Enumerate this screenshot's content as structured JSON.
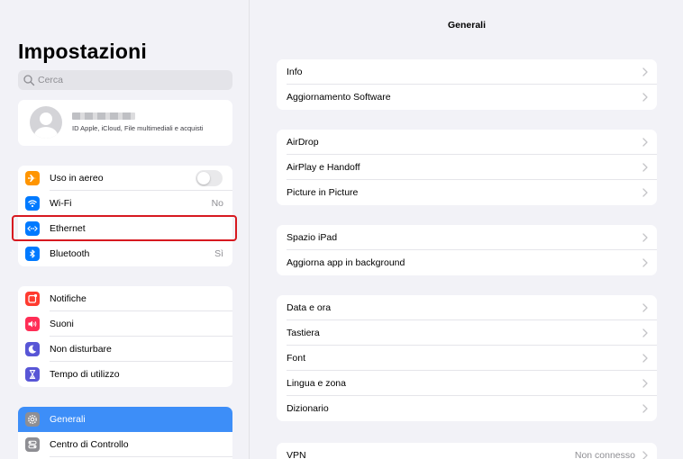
{
  "sidebar": {
    "title": "Impostazioni",
    "search": {
      "placeholder": "Cerca"
    },
    "account": {
      "subtitle": "ID Apple, iCloud, File multimediali e acquisti"
    },
    "group1": [
      {
        "label": "Uso in aereo",
        "icon": "airplane-icon",
        "color": "#ff9500",
        "toggle": false
      },
      {
        "label": "Wi-Fi",
        "icon": "wifi-icon",
        "color": "#007aff",
        "value": "No"
      },
      {
        "label": "Ethernet",
        "icon": "ethernet-icon",
        "color": "#007aff",
        "value": ""
      },
      {
        "label": "Bluetooth",
        "icon": "bluetooth-icon",
        "color": "#007aff",
        "value": "Sì"
      }
    ],
    "group2": [
      {
        "label": "Notifiche",
        "icon": "notifications-icon",
        "color": "#ff3b30"
      },
      {
        "label": "Suoni",
        "icon": "sound-icon",
        "color": "#ff2d55"
      },
      {
        "label": "Non disturbare",
        "icon": "moon-icon",
        "color": "#5856d6"
      },
      {
        "label": "Tempo di utilizzo",
        "icon": "hourglass-icon",
        "color": "#5856d6"
      }
    ],
    "group3": [
      {
        "label": "Generali",
        "icon": "gear-icon",
        "color": "#8e8e93",
        "selected": true
      },
      {
        "label": "Centro di Controllo",
        "icon": "control-center-icon",
        "color": "#8e8e93"
      }
    ]
  },
  "detail": {
    "title": "Generali",
    "groups": [
      [
        {
          "label": "Info"
        },
        {
          "label": "Aggiornamento Software"
        }
      ],
      [
        {
          "label": "AirDrop"
        },
        {
          "label": "AirPlay e Handoff"
        },
        {
          "label": "Picture in Picture"
        }
      ],
      [
        {
          "label": "Spazio iPad"
        },
        {
          "label": "Aggiorna app in background"
        }
      ],
      [
        {
          "label": "Data e ora"
        },
        {
          "label": "Tastiera"
        },
        {
          "label": "Font"
        },
        {
          "label": "Lingua e zona"
        },
        {
          "label": "Dizionario"
        }
      ],
      [
        {
          "label": "VPN",
          "value": "Non connesso"
        }
      ]
    ]
  }
}
